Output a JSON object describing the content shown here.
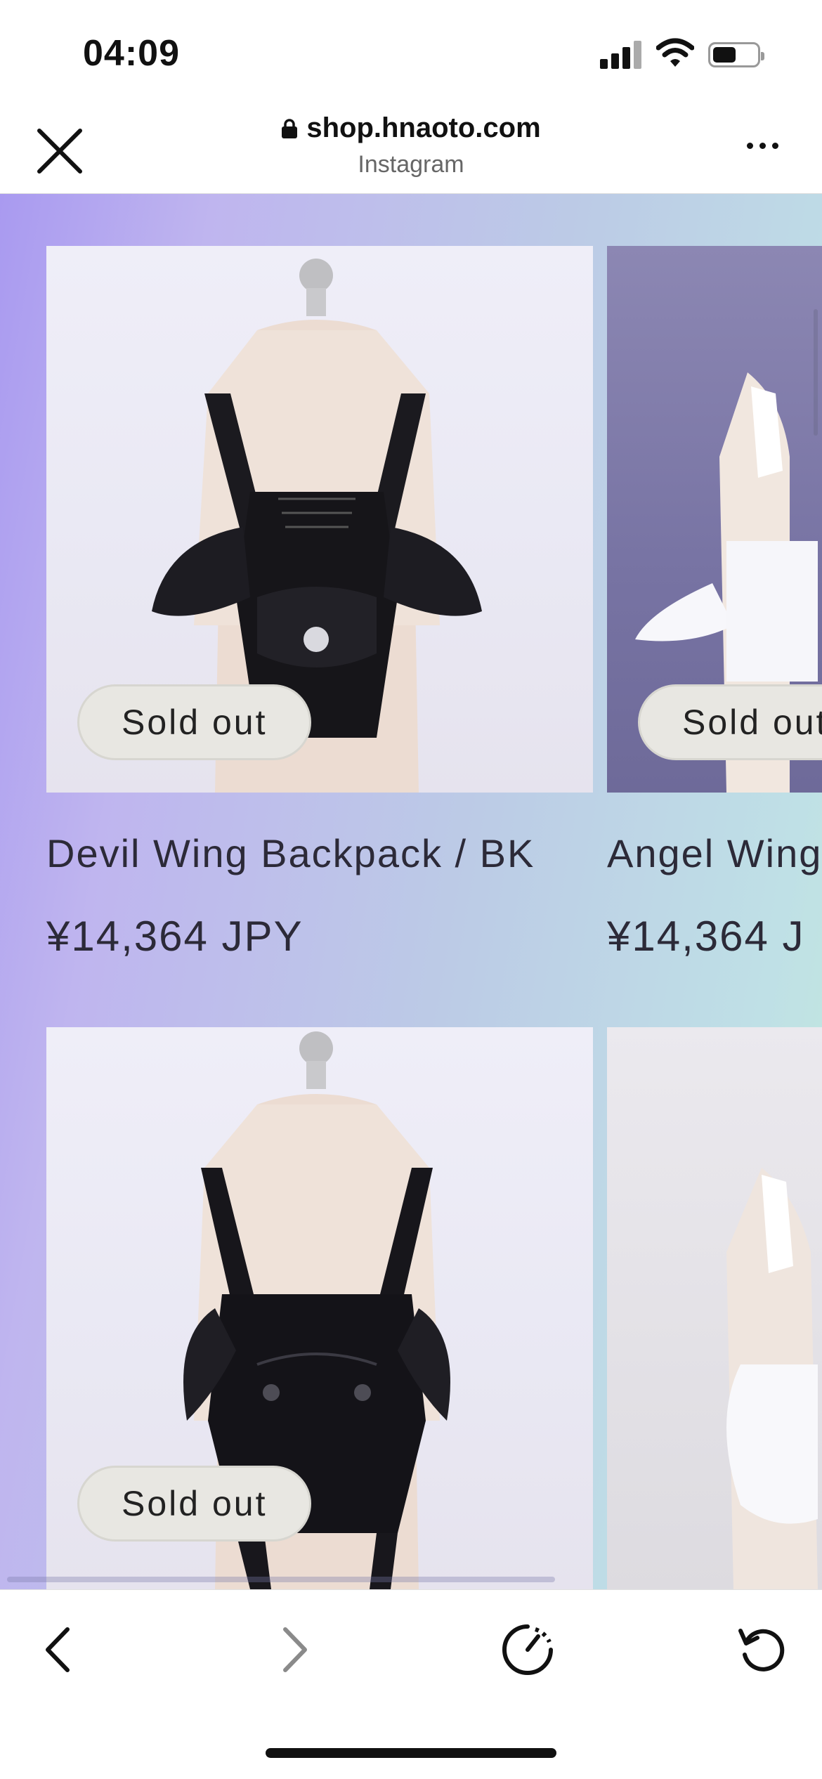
{
  "status": {
    "time": "04:09"
  },
  "browser": {
    "domain": "shop.hnaoto.com",
    "source": "Instagram"
  },
  "products": [
    {
      "title": "Devil Wing Backpack / BK",
      "price": "¥14,364 JPY",
      "badge": "Sold out"
    },
    {
      "title": "Angel Wing",
      "price": "¥14,364 J",
      "badge": "Sold out"
    },
    {
      "title": "",
      "price": "",
      "badge": "Sold out"
    }
  ],
  "colors": {
    "badge_bg": "#e8e7e2",
    "text": "#2c2a38",
    "page_gradient_start": "#a99af0",
    "page_gradient_end": "#c3eadb"
  },
  "icons": {
    "close": "close-icon",
    "lock": "lock-icon",
    "more": "more-icon",
    "back": "chevron-left-icon",
    "forward": "chevron-right-icon",
    "speed": "speedometer-icon",
    "reload": "reload-icon"
  }
}
